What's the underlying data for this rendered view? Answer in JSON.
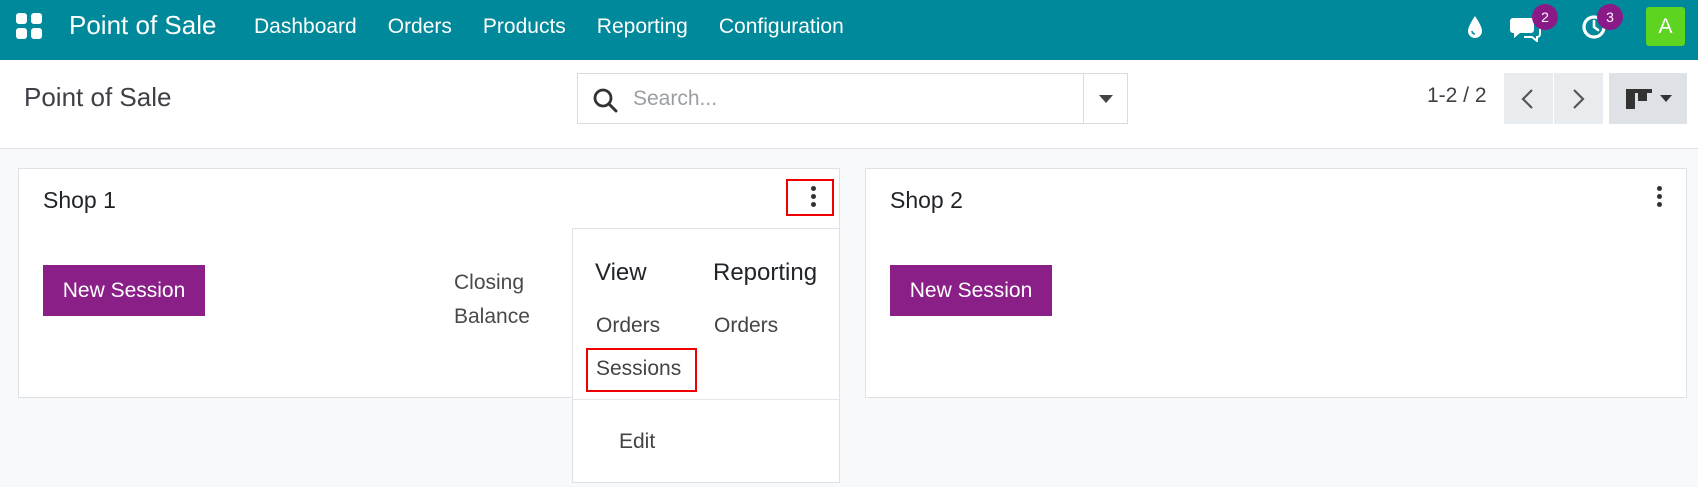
{
  "navbar": {
    "brand": "Point of Sale",
    "menu": [
      "Dashboard",
      "Orders",
      "Products",
      "Reporting",
      "Configuration"
    ],
    "messages_count": "2",
    "activities_count": "3",
    "avatar_letter": "A",
    "icons": [
      "apps-icon",
      "drop-icon",
      "chat-icon",
      "clock-icon"
    ],
    "color": "#00899a"
  },
  "control_panel": {
    "title": "Point of Sale",
    "search_placeholder": "Search...",
    "pager": "1-2 / 2"
  },
  "cards": [
    {
      "name": "Shop 1",
      "button_label": "New Session",
      "closing_label": "Closing Balance",
      "dropdown": {
        "view_title": "View",
        "view_items": [
          "Orders",
          "Sessions"
        ],
        "reporting_title": "Reporting",
        "reporting_items": [
          "Orders"
        ],
        "edit_label": "Edit"
      }
    },
    {
      "name": "Shop 2",
      "button_label": "New Session"
    }
  ],
  "colors": {
    "accent": "#8b1f88",
    "badge": "#8b1a89",
    "avatar": "#5dd41f",
    "highlight": "#e00000"
  }
}
